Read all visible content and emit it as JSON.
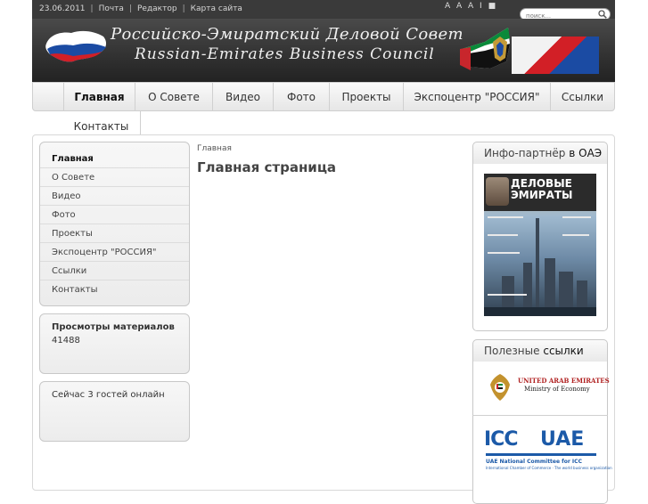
{
  "topbar": {
    "date": "23.06.2011",
    "links": [
      "Почта",
      "Редактор",
      "Карта сайта"
    ],
    "font_size_controls": "A A A I ■",
    "search_placeholder": "поиск..."
  },
  "banner": {
    "title_ru": "Российско-Эмиратский Деловой Совет",
    "title_en": "Russian-Emirates Business Council"
  },
  "nav": {
    "items": [
      "Главная",
      "О Совете",
      "Видео",
      "Фото",
      "Проекты",
      "Экспоцентр \"РОССИЯ\"",
      "Ссылки",
      "Контакты"
    ],
    "active": "Главная"
  },
  "left_menu": {
    "items": [
      "Главная",
      "О Совете",
      "Видео",
      "Фото",
      "Проекты",
      "Экспоцентр \"РОССИЯ\"",
      "Ссылки",
      "Контакты"
    ]
  },
  "views": {
    "label": "Просмотры материалов",
    "value": "41488"
  },
  "online": {
    "text": "Сейчас 3 гостей онлайн"
  },
  "content": {
    "breadcrumb": "Главная",
    "title": "Главная страница"
  },
  "right": {
    "info_partner_a": "Инфо-партнёр",
    "info_partner_b": "в ОАЭ",
    "magazine_title_1": "ДЕЛОВЫЕ",
    "magazine_title_2": "ЭМИРАТЫ",
    "useful_a": "Полезные",
    "useful_b": "ссылки",
    "uae_ministry_line1": "UNITED ARAB EMIRATES",
    "uae_ministry_line2": "Ministry of Economy",
    "icc_left": "ICC",
    "icc_right": "UAE",
    "icc_line1": "UAE National Committee for ICC",
    "icc_line2": "International Chamber of Commerce · The world business organization"
  },
  "colors": {
    "topbar": "#3a3a3a",
    "banner": "#2d2d2d",
    "nav_bg": "#eeeeee",
    "icc_blue": "#1c5aa8",
    "uae_red": "#b02020"
  }
}
